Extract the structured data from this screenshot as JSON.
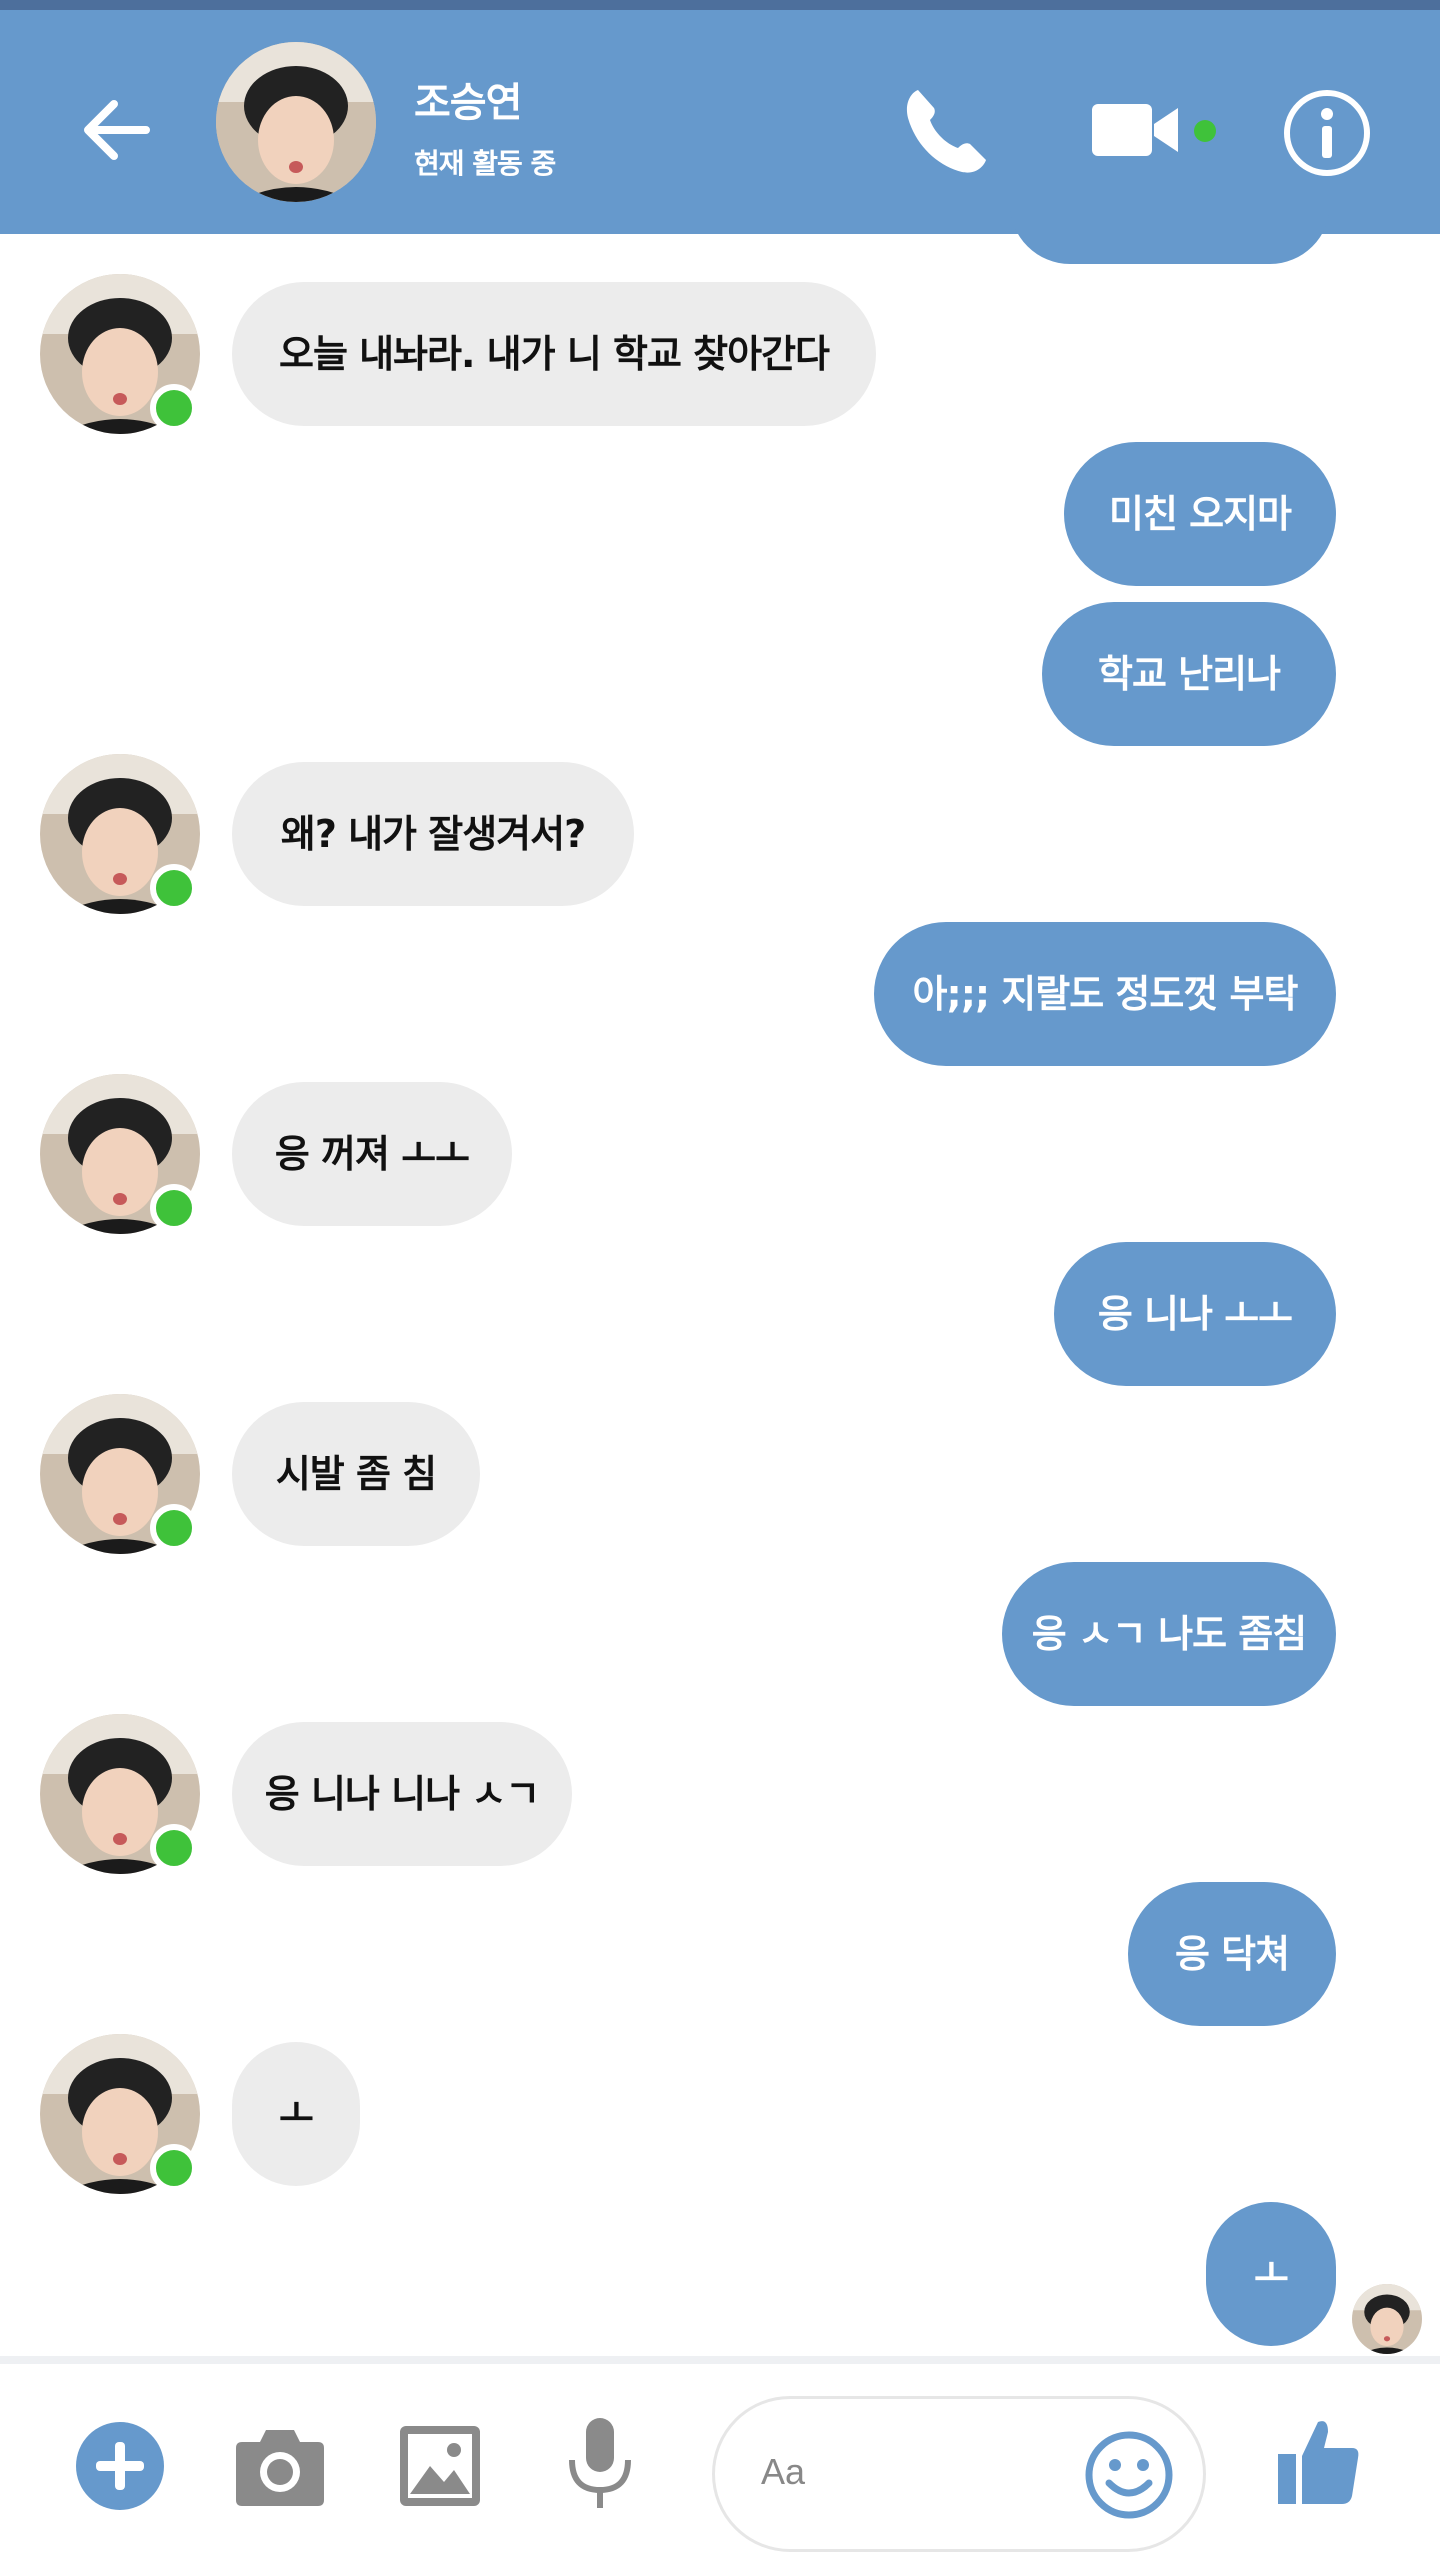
{
  "header": {
    "contact_name": "조승연",
    "status": "현재 활동 중"
  },
  "colors": {
    "header_bg": "#6699cc",
    "outgoing_bubble": "#6699cc",
    "incoming_bubble": "#ececec",
    "online_dot": "#3fc23a"
  },
  "icons": {
    "back": "arrow-left-icon",
    "call": "phone-icon",
    "video": "video-camera-icon",
    "info": "info-icon",
    "add": "plus-circle-icon",
    "camera": "camera-icon",
    "gallery": "image-icon",
    "voice": "microphone-icon",
    "emoji": "smiley-icon",
    "like": "thumbs-up-icon"
  },
  "messages": [
    {
      "from": "them",
      "text": "오늘 내놔라. 내가 니 학교 찾아간다"
    },
    {
      "from": "me",
      "text": "미친 오지마"
    },
    {
      "from": "me",
      "text": "학교 난리나"
    },
    {
      "from": "them",
      "text": "왜? 내가 잘생겨서?"
    },
    {
      "from": "me",
      "text": "아;;; 지랄도 정도껏 부탁"
    },
    {
      "from": "them",
      "text": "응 꺼져 ㅗㅗ"
    },
    {
      "from": "me",
      "text": "응 니나 ㅗㅗ"
    },
    {
      "from": "them",
      "text": "시발 좀 침"
    },
    {
      "from": "me",
      "text": "응 ㅅㄱ 나도 좀침"
    },
    {
      "from": "them",
      "text": "응 니나 니나 ㅅㄱ"
    },
    {
      "from": "me",
      "text": "응 닥쳐"
    },
    {
      "from": "them",
      "text": "ㅗ"
    },
    {
      "from": "me",
      "text": "ㅗ"
    }
  ],
  "composer": {
    "placeholder": "Aa"
  }
}
